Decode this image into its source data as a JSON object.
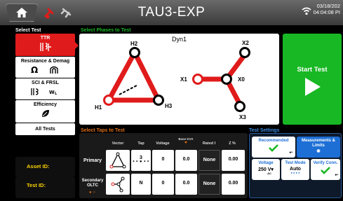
{
  "header": {
    "title": "TAU3-EXP",
    "date": "03/18/202",
    "time": "04:04:08 PI"
  },
  "left": {
    "select_test_label": "Select Test",
    "tests": [
      {
        "label": "TTR",
        "selected": true
      },
      {
        "label": "Resistance & Demag"
      },
      {
        "label": "SCI & FRSL"
      },
      {
        "label": "Efficiency"
      },
      {
        "label": "All Tests"
      }
    ],
    "asset_id_label": "Asset ID:",
    "test_id_label": "Test ID:"
  },
  "phases": {
    "label": "Select Phases to Test",
    "vector_group": "Dyn1",
    "nodes": {
      "h1": "H1",
      "h2": "H2",
      "h3": "H3",
      "x0": "X0",
      "x1": "X1",
      "x2": "X2",
      "x3": "X3"
    }
  },
  "start": {
    "label": "Start Test"
  },
  "taps": {
    "label": "Select Taps to Test",
    "columns": [
      "Vector",
      "Tap",
      "Voltage",
      "Base KVA",
      "Rated I",
      "Z %"
    ],
    "rows": [
      {
        "label": "Primary",
        "tap": "3",
        "voltage": "0",
        "base_kva": "0.0",
        "rated_i": "None",
        "z": "0.00"
      },
      {
        "label": "Secondary OLTC",
        "tap": "N",
        "voltage": "0",
        "base_kva": "0.0",
        "rated_i": "None",
        "z": "0.00"
      }
    ]
  },
  "settings": {
    "label": "Test Settings",
    "recommended": "Recommended",
    "measurements_limits": "Measurements & Limits",
    "voltage_label": "Voltage",
    "voltage_value": "250 V",
    "voltage_unit": "AC",
    "test_mode_label": "Test Mode",
    "test_mode_value": "Auto",
    "verify_conn": "Verify Conn."
  },
  "colors": {
    "red": "#e01b1b",
    "green": "#18b824",
    "blue": "#1d6fd6",
    "yellow": "#ffd400"
  }
}
